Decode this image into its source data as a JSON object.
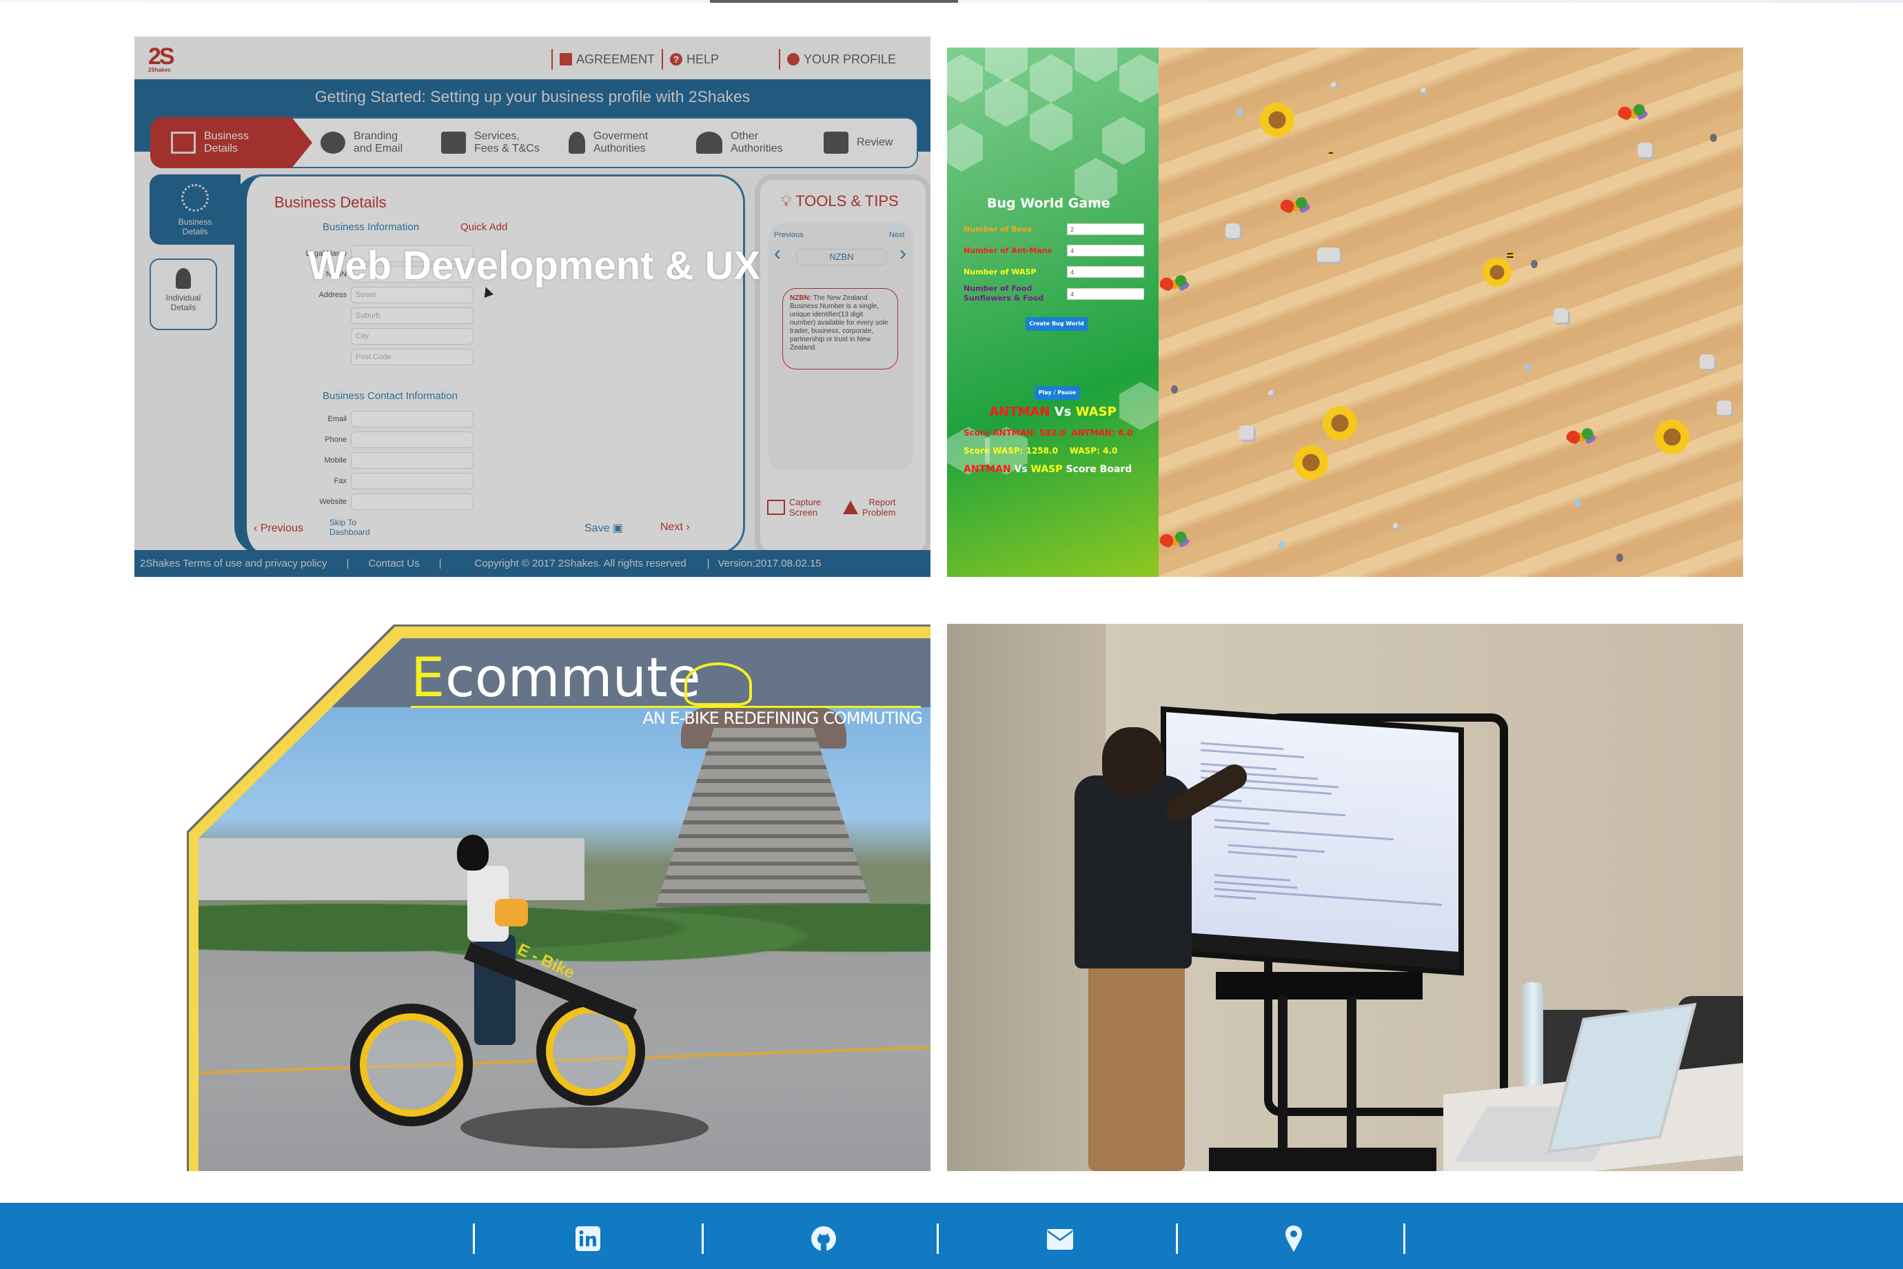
{
  "cards": [
    {
      "id": "web-dev",
      "overlay_title": "Web Development & UX",
      "screenshot": {
        "logo_text": "2S",
        "logo_sub": "2Shakes",
        "header_links": [
          "AGREEMENT",
          "HELP",
          "YOUR PROFILE"
        ],
        "banner_title": "Getting Started: Setting up your business profile with 2Shakes",
        "steps": [
          {
            "label_1": "Business",
            "label_2": "Details",
            "active": true
          },
          {
            "label_1": "Branding",
            "label_2": "and Email"
          },
          {
            "label_1": "Services,",
            "label_2": "Fees & T&Cs"
          },
          {
            "label_1": "Goverment",
            "label_2": "Authorities"
          },
          {
            "label_1": "Other",
            "label_2": "Authorities"
          },
          {
            "label_1": "Review",
            "label_2": ""
          }
        ],
        "side_tabs": [
          {
            "label_1": "Business",
            "label_2": "Details"
          },
          {
            "label_1": "Individual",
            "label_2": "Details"
          }
        ],
        "form_title": "Business Details",
        "section_business_info": "Business Information",
        "quick_add": "Quick Add",
        "fields_info": [
          {
            "label": "Legal Name",
            "placeholder": ""
          },
          {
            "label": "NZBN",
            "placeholder": ""
          },
          {
            "label": "Address",
            "placeholder": "Street"
          },
          {
            "label": "",
            "placeholder": "Suburb"
          },
          {
            "label": "",
            "placeholder": "City"
          },
          {
            "label": "",
            "placeholder": "Post Code"
          }
        ],
        "section_contact_info": "Business Contact Information",
        "fields_contact": [
          {
            "label": "Email"
          },
          {
            "label": "Phone"
          },
          {
            "label": "Mobile"
          },
          {
            "label": "Fax"
          },
          {
            "label": "Website"
          }
        ],
        "btn_previous": "Previous",
        "btn_skip_1": "Skip To",
        "btn_skip_2": "Dashboard",
        "btn_save": "Save",
        "btn_next": "Next",
        "tools_title": "TOOLS & TIPS",
        "tools_prev": "Previous",
        "tools_next": "Next",
        "tools_current": "NZBN",
        "tip_key": "NZBN:",
        "tip_text": "The New Zealand Business Number is a single, unique identifier(13 digit number) available for every sole trader, business, corporate, partnership or trust in New Zealand.",
        "capture_1": "Capture",
        "capture_2": "Screen",
        "report_1": "Report",
        "report_2": "Problem",
        "footer_terms": "2Shakes Terms of use and privacy policy",
        "footer_contact": "Contact Us",
        "footer_copyright": "Copyright © 2017 2Shakes. All rights reserved",
        "footer_version": "Version:2017.08.02.15"
      }
    },
    {
      "id": "bug-world",
      "game_title": "Bug World Game",
      "fields": [
        {
          "label": "Number of Bees",
          "value": "2",
          "color": "#f5a623"
        },
        {
          "label": "Number of Ant-Mans",
          "value": "4",
          "color": "#ff1a1a"
        },
        {
          "label": "Number of WASP",
          "value": "4",
          "color": "#ffff1a"
        },
        {
          "label": "Number of Food Sunflowers & Food",
          "value": "4",
          "color": "#7a1a8c"
        }
      ],
      "btn_create": "Create Bug World",
      "btn_play": "Play / Pause",
      "vs_left": "ANTMAN",
      "vs_mid": "Vs",
      "vs_right": "WASP",
      "score_antman": "Score ANTMAN: 582.0  ANTMAN: 4.0",
      "score_wasp": "Score WASP: 1258.0    WASP: 4.0",
      "scoreboard_left": "ANTMAN",
      "scoreboard_mid": "Vs",
      "scoreboard_right": "WASP",
      "scoreboard_tail": "Score Board"
    },
    {
      "id": "ecommute",
      "title_first": "E",
      "title_rest": "commute",
      "tagline": "AN E-BIKE REDEFINING COMMUTING",
      "bike_label": "E - Bike"
    },
    {
      "id": "presentation-photo"
    }
  ],
  "footer": {
    "color": "#1279c3",
    "icons": [
      {
        "name": "linkedin-icon"
      },
      {
        "name": "github-icon"
      },
      {
        "name": "email-icon"
      },
      {
        "name": "location-pin-icon"
      }
    ]
  }
}
